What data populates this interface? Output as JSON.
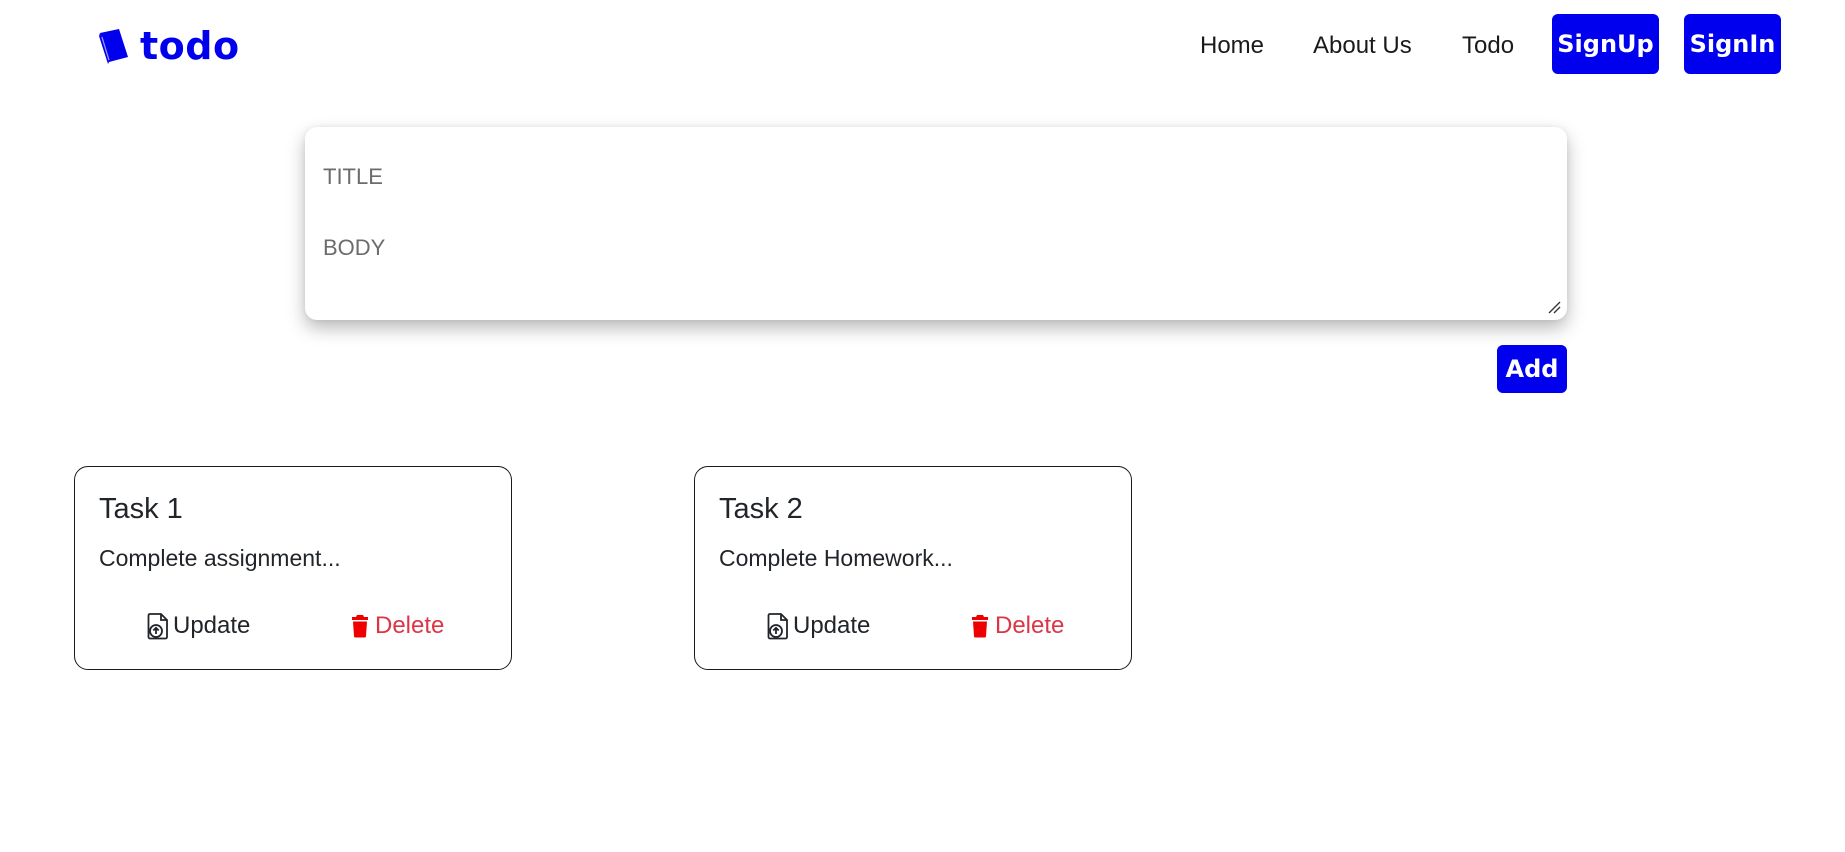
{
  "app": {
    "brand": "todo",
    "brand_icon": "book-icon",
    "accent_color": "#0000ee",
    "danger_color": "#dc3545"
  },
  "nav": {
    "links": [
      {
        "label": "Home"
      },
      {
        "label": "About Us"
      },
      {
        "label": "Todo"
      }
    ],
    "signup_label": "SignUp",
    "signin_label": "SignIn"
  },
  "form": {
    "title_placeholder": "TITLE",
    "title_value": "",
    "body_placeholder": "BODY",
    "body_value": "",
    "add_label": "Add"
  },
  "tasks": [
    {
      "title": "Task 1",
      "body": "Complete assignment...",
      "update_label": "Update",
      "update_icon": "file-upload-icon",
      "delete_label": "Delete",
      "delete_icon": "trash-icon"
    },
    {
      "title": "Task 2",
      "body": "Complete Homework...",
      "update_label": "Update",
      "update_icon": "file-upload-icon",
      "delete_label": "Delete",
      "delete_icon": "trash-icon"
    }
  ]
}
